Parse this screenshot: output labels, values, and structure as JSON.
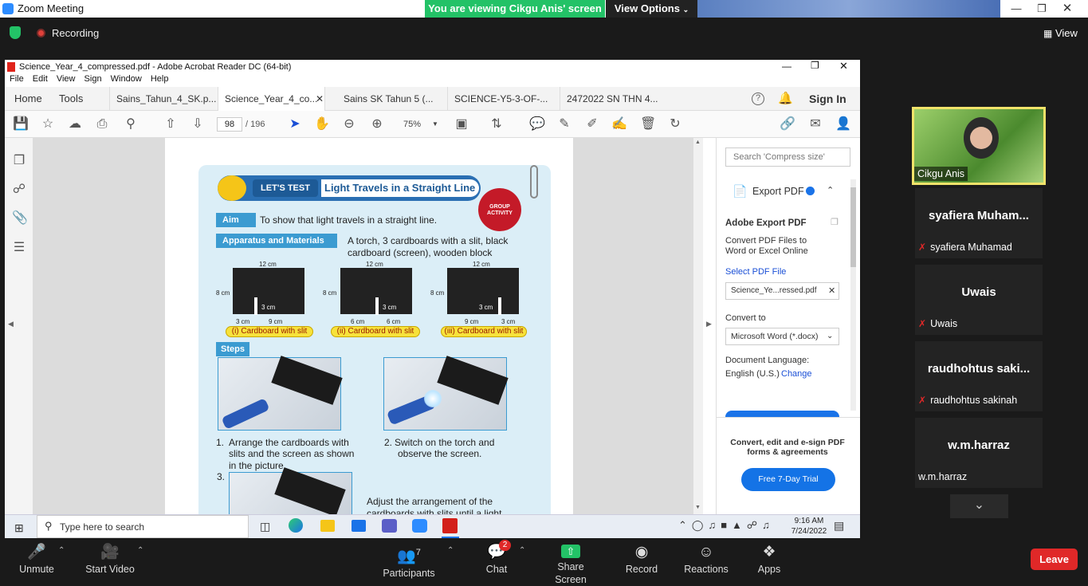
{
  "zoom": {
    "title": "Zoom Meeting",
    "viewing_banner": "You are viewing Cikgu Anis' screen",
    "view_options": "View Options",
    "recording": "Recording",
    "view": "View",
    "leave": "Leave",
    "toolbar": [
      {
        "label": "Unmute",
        "icon": "mic-muted-icon"
      },
      {
        "label": "Start Video",
        "icon": "video-off-icon"
      },
      {
        "label": "Participants",
        "count": "7"
      },
      {
        "label": "Chat",
        "badge": "2"
      },
      {
        "label": "Share Screen"
      },
      {
        "label": "Record"
      },
      {
        "label": "Reactions"
      },
      {
        "label": "Apps"
      }
    ],
    "participants": [
      {
        "name": "Cikgu Anis"
      },
      {
        "title": "syafiera  Muham...",
        "sub": "syafiera Muhamad"
      },
      {
        "title": "Uwais",
        "sub": "Uwais"
      },
      {
        "title": "raudhohtus  saki...",
        "sub": "raudhohtus sakinah"
      },
      {
        "title": "w.m.harraz",
        "sub": "w.m.harraz"
      }
    ]
  },
  "acrobat": {
    "title": "Science_Year_4_compressed.pdf - Adobe Acrobat Reader DC (64-bit)",
    "menu": [
      "File",
      "Edit",
      "View",
      "Sign",
      "Window",
      "Help"
    ],
    "tabs": [
      "Home",
      "Tools",
      "Sains_Tahun_4_SK.p...",
      "Science_Year_4_co...",
      "Sains SK Tahun 5 (...",
      "SCIENCE-Y5-3-OF-...",
      "2472022 SN THN 4..."
    ],
    "sign_in": "Sign In",
    "page_current": "98",
    "page_total": "/ 196",
    "zoom_level": "75%",
    "panel": {
      "search_placeholder": "Search 'Compress size'",
      "export_title": "Export PDF",
      "adobe_export": "Adobe Export PDF",
      "export_desc": "Convert PDF Files to Word or Excel Online",
      "select_pdf": "Select PDF File",
      "file_name": "Science_Ye...ressed.pdf",
      "convert_to": "Convert to",
      "convert_value": "Microsoft Word (*.docx)",
      "doc_lang": "Document Language:",
      "lang_value": "English (U.S.)",
      "change": "Change",
      "promo": "Convert, edit and e-sign PDF forms & agreements",
      "trial": "Free 7-Day Trial"
    }
  },
  "page": {
    "lets_test": "LET'S TEST",
    "heading": "Light Travels in a Straight Line",
    "group_activity": "GROUP ACTIVITY",
    "aim_label": "Aim",
    "aim_text": "To show that light travels in a straight line.",
    "app_label": "Apparatus and Materials",
    "app_text1": "A torch, 3 cardboards with a slit, black",
    "app_text2": "cardboard (screen), wooden block",
    "cards": [
      {
        "width": "12 cm",
        "height": "8 cm",
        "slit": "3 cm",
        "b1": "3 cm",
        "b2": "9 cm",
        "caption": "(i) Cardboard with slit"
      },
      {
        "width": "12 cm",
        "height": "8 cm",
        "slit": "3 cm",
        "b1": "6 cm",
        "b2": "6 cm",
        "caption": "(ii) Cardboard with slit"
      },
      {
        "width": "12 cm",
        "height": "8 cm",
        "slit": "3 cm",
        "b1": "9 cm",
        "b2": "3 cm",
        "caption": "(iii) Cardboard with slit"
      }
    ],
    "steps_label": "Steps",
    "step1_num": "1.",
    "step1": [
      "Arrange the cardboards with",
      "slits and the screen as shown",
      "in the picture."
    ],
    "step2_num": "2.",
    "step2": [
      "Switch on the torch and",
      "observe the screen."
    ],
    "step3_num": "3.",
    "step3": [
      "Adjust the arrangement of the",
      "cardboards with slits until a light"
    ]
  },
  "taskbar": {
    "search": "Type here to search",
    "time": "9:16 AM",
    "date": "7/24/2022"
  }
}
